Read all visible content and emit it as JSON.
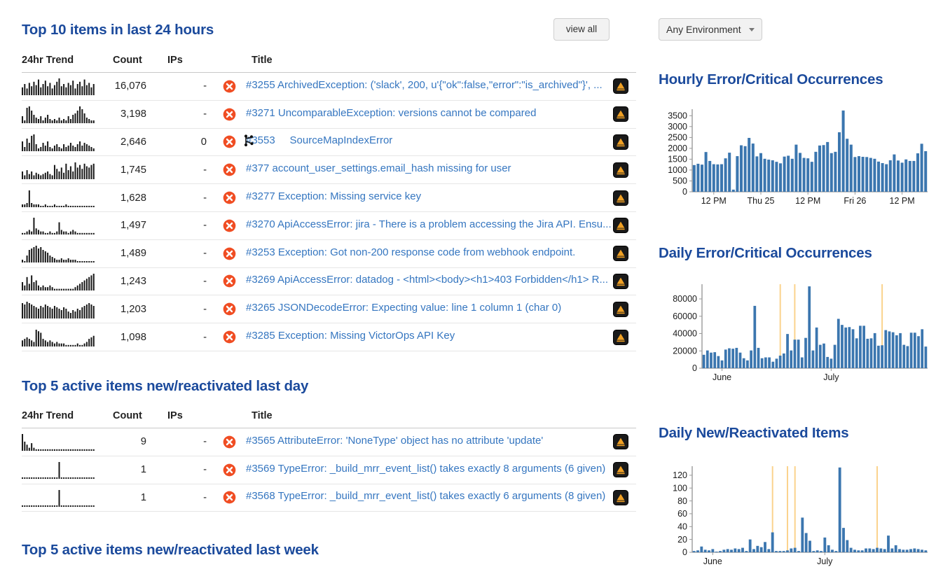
{
  "header": {
    "view_all_label": "view all",
    "environment_label": "Any Environment",
    "environment_caret_icon": "chevron-down-icon"
  },
  "sections": {
    "top10": {
      "title": "Top 10 items in last 24 hours",
      "columns": [
        "24hr Trend",
        "Count",
        "IPs",
        "Title"
      ],
      "rows": [
        {
          "count": "16,076",
          "ips": "-",
          "severity": "error",
          "title": "#3255 ArchivedException: ('slack', 200, u'{\"ok\":false,\"error\":\"is_archived\"}', ...",
          "spark": [
            7,
            10,
            6,
            11,
            8,
            12,
            9,
            14,
            7,
            10,
            13,
            8,
            11,
            6,
            9,
            12,
            15,
            8,
            10,
            7,
            11,
            9,
            13,
            6,
            10,
            12,
            8,
            14,
            9,
            11,
            7,
            10
          ]
        },
        {
          "count": "3,198",
          "ips": "-",
          "severity": "error",
          "title": "#3271 UncomparableException: versions cannot be compared",
          "spark": [
            5,
            2,
            11,
            12,
            9,
            6,
            4,
            3,
            5,
            2,
            4,
            6,
            3,
            2,
            3,
            2,
            4,
            2,
            3,
            2,
            5,
            3,
            6,
            7,
            9,
            12,
            10,
            7,
            4,
            3,
            2,
            2
          ]
        },
        {
          "count": "2,646",
          "ips": "0",
          "severity": "error",
          "title": "#3553 SourceMapIndexError",
          "spark": [
            7,
            3,
            9,
            6,
            11,
            12,
            5,
            2,
            3,
            6,
            4,
            7,
            3,
            2,
            4,
            5,
            3,
            2,
            5,
            3,
            4,
            6,
            4,
            3,
            5,
            7,
            4,
            6,
            5,
            4,
            3,
            2
          ]
        },
        {
          "count": "1,745",
          "ips": "-",
          "severity": "error",
          "title": "#377 account_user_settings.email_hash missing for user",
          "spark": [
            6,
            3,
            7,
            4,
            6,
            3,
            5,
            4,
            3,
            4,
            5,
            6,
            4,
            3,
            11,
            8,
            6,
            9,
            5,
            12,
            7,
            10,
            6,
            13,
            9,
            11,
            8,
            12,
            10,
            9,
            11,
            12
          ]
        },
        {
          "count": "1,628",
          "ips": "-",
          "severity": "error",
          "title": "#3277 Exception: Missing service key",
          "spark": [
            2,
            2,
            3,
            12,
            3,
            2,
            2,
            2,
            1,
            1,
            2,
            1,
            1,
            1,
            2,
            1,
            1,
            1,
            1,
            2,
            1,
            1,
            1,
            1,
            1,
            1,
            1,
            1,
            1,
            1,
            1,
            1
          ]
        },
        {
          "count": "1,497",
          "ips": "-",
          "severity": "error",
          "title": "#3270 ApiAccessError: jira - There is a problem accessing the Jira API. Ensu...",
          "spark": [
            1,
            1,
            2,
            3,
            2,
            11,
            4,
            3,
            2,
            2,
            1,
            1,
            2,
            1,
            1,
            2,
            8,
            3,
            2,
            2,
            1,
            2,
            3,
            2,
            1,
            1,
            1,
            1,
            1,
            1,
            1,
            1
          ]
        },
        {
          "count": "1,489",
          "ips": "-",
          "severity": "error",
          "title": "#3253 Exception: Got non-200 response code from webhook endpoint.",
          "spark": [
            2,
            1,
            5,
            9,
            10,
            11,
            12,
            10,
            11,
            9,
            8,
            7,
            5,
            4,
            3,
            2,
            2,
            3,
            2,
            2,
            3,
            2,
            2,
            2,
            1,
            1,
            1,
            1,
            1,
            1,
            1,
            1
          ]
        },
        {
          "count": "1,243",
          "ips": "-",
          "severity": "error",
          "title": "#3269 ApiAccessError: datadog - <html><body><h1>403 Forbidden</h1> R...",
          "spark": [
            5,
            3,
            8,
            4,
            9,
            5,
            6,
            3,
            2,
            3,
            2,
            2,
            3,
            2,
            1,
            1,
            1,
            1,
            1,
            1,
            1,
            1,
            1,
            2,
            3,
            4,
            5,
            6,
            7,
            8,
            9,
            10
          ]
        },
        {
          "count": "1,203",
          "ips": "-",
          "severity": "error",
          "title": "#3265 JSONDecodeError: Expecting value: line 1 column 1 (char 0)",
          "spark": [
            11,
            10,
            12,
            11,
            10,
            9,
            8,
            7,
            9,
            8,
            10,
            9,
            8,
            7,
            9,
            8,
            7,
            6,
            8,
            7,
            5,
            4,
            6,
            5,
            7,
            6,
            8,
            9,
            10,
            11,
            10,
            9
          ]
        },
        {
          "count": "1,098",
          "ips": "-",
          "severity": "error",
          "title": "#3285 Exception: Missing VictorOps API Key",
          "spark": [
            4,
            5,
            6,
            5,
            4,
            3,
            11,
            10,
            9,
            5,
            4,
            3,
            4,
            3,
            2,
            3,
            2,
            2,
            2,
            1,
            1,
            1,
            1,
            1,
            2,
            1,
            1,
            2,
            3,
            5,
            6,
            7
          ]
        }
      ]
    },
    "lastday": {
      "title": "Top 5 active items new/reactivated last day",
      "columns": [
        "24hr Trend",
        "Count",
        "IPs",
        "Title"
      ],
      "rows": [
        {
          "count": "9",
          "ips": "-",
          "severity": "error",
          "title": "#3565 AttributeError: 'NoneType' object has no attribute 'update'",
          "spark": [
            11,
            6,
            4,
            2,
            5,
            2,
            1,
            1,
            1,
            1,
            1,
            1,
            1,
            1,
            1,
            1,
            1,
            1,
            1,
            1,
            1,
            1,
            1,
            1,
            1,
            1,
            1,
            1,
            1,
            1,
            1,
            1
          ]
        },
        {
          "count": "1",
          "ips": "-",
          "severity": "error",
          "title": "#3569 TypeError: _build_mrr_event_list() takes exactly 8 arguments (6 given)",
          "spark": [
            1,
            1,
            1,
            1,
            1,
            1,
            1,
            1,
            1,
            1,
            1,
            1,
            1,
            1,
            1,
            1,
            12,
            1,
            1,
            1,
            1,
            1,
            1,
            1,
            1,
            1,
            1,
            1,
            1,
            1,
            1,
            1
          ]
        },
        {
          "count": "1",
          "ips": "-",
          "severity": "error",
          "title": "#3568 TypeError: _build_mrr_event_list() takes exactly 6 arguments (8 given)",
          "spark": [
            1,
            1,
            1,
            1,
            1,
            1,
            1,
            1,
            1,
            1,
            1,
            1,
            1,
            1,
            1,
            1,
            12,
            1,
            1,
            1,
            1,
            1,
            1,
            1,
            1,
            1,
            1,
            1,
            1,
            1,
            1,
            1
          ]
        }
      ]
    },
    "lastweek": {
      "title": "Top 5 active items new/reactivated last week"
    }
  },
  "chart_data": [
    {
      "id": "hourly",
      "type": "bar",
      "title": "Hourly Error/Critical Occurrences",
      "xlabel": "",
      "ylabel": "",
      "ylim": [
        0,
        3800
      ],
      "yticks": [
        0,
        500,
        1000,
        1500,
        2000,
        2500,
        3000,
        3500
      ],
      "grid": false,
      "bar_color": "#3b76af",
      "xticks": [
        {
          "label": "12 PM",
          "index": 5
        },
        {
          "label": "Thu 25",
          "index": 17
        },
        {
          "label": "12 PM",
          "index": 29
        },
        {
          "label": "Fri 26",
          "index": 41
        },
        {
          "label": "12 PM",
          "index": 53
        }
      ],
      "values": [
        1230,
        1290,
        1250,
        1830,
        1420,
        1270,
        1260,
        1270,
        1540,
        1800,
        100,
        1640,
        2140,
        2100,
        2480,
        2220,
        1630,
        1780,
        1520,
        1480,
        1450,
        1380,
        1310,
        1620,
        1660,
        1520,
        2170,
        1790,
        1560,
        1540,
        1380,
        1840,
        2130,
        2150,
        2290,
        1780,
        1840,
        2740,
        3740,
        2440,
        2170,
        1600,
        1640,
        1610,
        1600,
        1560,
        1520,
        1390,
        1320,
        1270,
        1450,
        1720,
        1440,
        1340,
        1490,
        1420,
        1420,
        1770,
        2210,
        1870
      ]
    },
    {
      "id": "daily_errors",
      "type": "bar",
      "title": "Daily Error/Critical Occurrences",
      "xlabel": "",
      "ylabel": "",
      "ylim": [
        0,
        97000
      ],
      "yticks": [
        0,
        20000,
        40000,
        60000,
        80000
      ],
      "grid": false,
      "bar_color": "#3b76af",
      "marker_color": "#fbd38d",
      "xticks": [
        {
          "label": "June",
          "index": 5
        },
        {
          "label": "July",
          "index": 35
        }
      ],
      "markers": [
        21,
        25,
        49
      ],
      "values": [
        15500,
        20500,
        18000,
        18500,
        14000,
        9000,
        21500,
        23000,
        22500,
        23500,
        18000,
        11500,
        9000,
        20500,
        72000,
        23500,
        11500,
        12500,
        12500,
        7500,
        11000,
        14500,
        17000,
        39500,
        20500,
        33000,
        33000,
        12500,
        35000,
        94500,
        20500,
        47000,
        27000,
        28500,
        13000,
        11000,
        27000,
        57000,
        50000,
        47000,
        47500,
        45000,
        34500,
        49000,
        49000,
        34000,
        34500,
        40500,
        26000,
        26500,
        44000,
        42500,
        41500,
        38000,
        40500,
        27000,
        25500,
        41000,
        41000,
        37000,
        45000,
        25000
      ]
    },
    {
      "id": "daily_new",
      "type": "bar",
      "title": "Daily New/Reactivated Items",
      "xlabel": "",
      "ylabel": "",
      "ylim": [
        0,
        134
      ],
      "yticks": [
        0,
        20,
        40,
        60,
        80,
        100,
        120
      ],
      "grid": false,
      "bar_color": "#3b76af",
      "marker_color": "#fbd38d",
      "xticks": [
        {
          "label": "June",
          "index": 5
        },
        {
          "label": "July",
          "index": 35
        }
      ],
      "markers": [
        21,
        25,
        27,
        49
      ],
      "values": [
        2,
        3,
        9,
        4,
        3,
        5,
        1,
        2,
        4,
        5,
        4,
        6,
        5,
        7,
        2,
        20,
        5,
        10,
        8,
        16,
        5,
        31,
        2,
        2,
        2,
        3,
        6,
        7,
        2,
        54,
        30,
        18,
        2,
        3,
        2,
        23,
        11,
        4,
        2,
        132,
        38,
        19,
        7,
        4,
        3,
        3,
        6,
        6,
        5,
        7,
        6,
        5,
        26,
        6,
        11,
        5,
        4,
        4,
        5,
        6,
        5,
        4,
        3
      ]
    }
  ]
}
